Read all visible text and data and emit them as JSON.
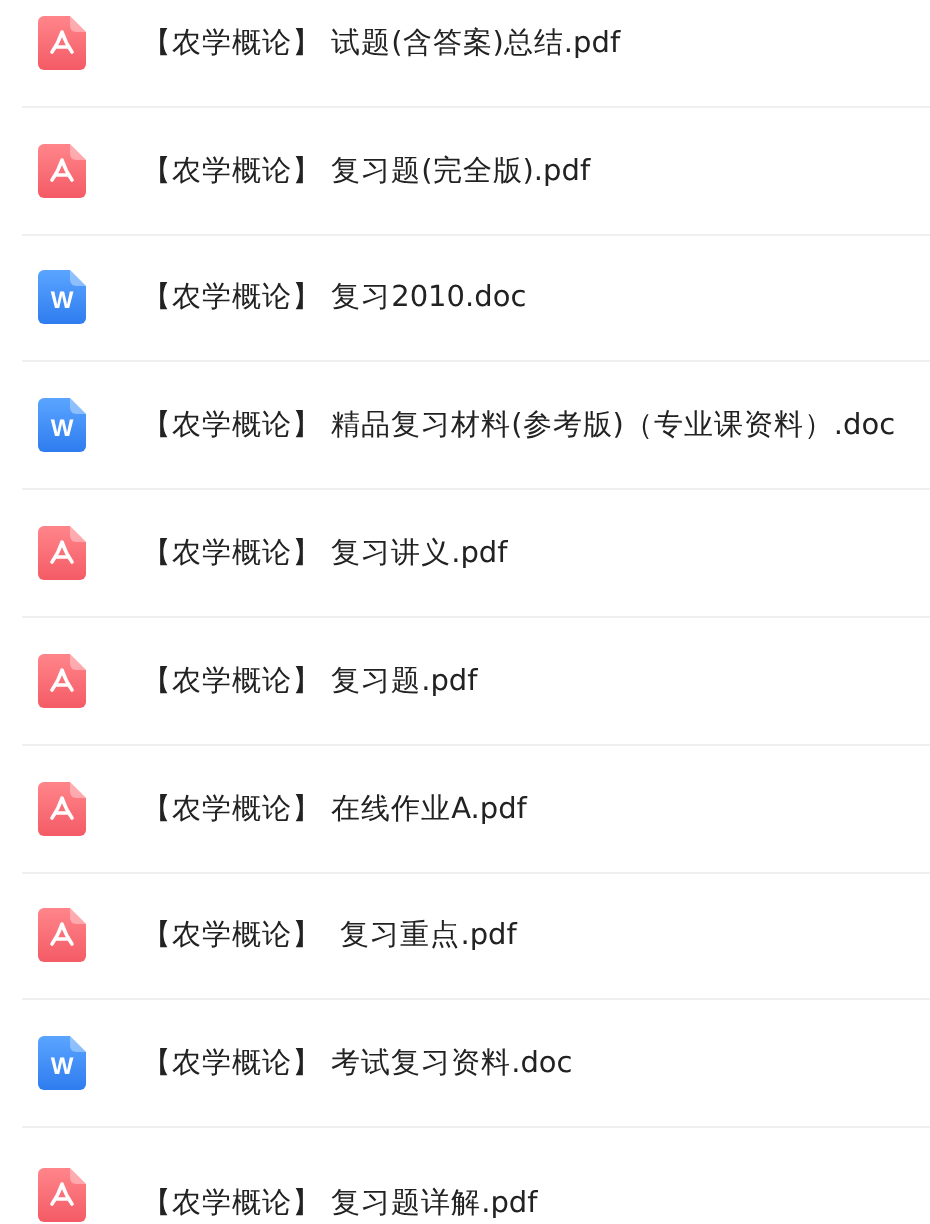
{
  "files": [
    {
      "kind": "pdf",
      "name": "【农学概论】 试题(含答案)总结.pdf"
    },
    {
      "kind": "pdf",
      "name": "【农学概论】 复习题(完全版).pdf"
    },
    {
      "kind": "doc",
      "icon_letter": "W",
      "name": "【农学概论】 复习2010.doc"
    },
    {
      "kind": "doc",
      "icon_letter": "W",
      "name": "【农学概论】 精品复习材料(参考版)（专业课资料）.doc"
    },
    {
      "kind": "pdf",
      "name": "【农学概论】 复习讲义.pdf"
    },
    {
      "kind": "pdf",
      "name": "【农学概论】 复习题.pdf"
    },
    {
      "kind": "pdf",
      "name": "【农学概论】 在线作业A.pdf"
    },
    {
      "kind": "pdf",
      "name": "【农学概论】  复习重点.pdf"
    },
    {
      "kind": "doc",
      "icon_letter": "W",
      "name": "【农学概论】 考试复习资料.doc"
    },
    {
      "kind": "pdf",
      "name": "【农学概论】 复习题详解.pdf"
    }
  ]
}
